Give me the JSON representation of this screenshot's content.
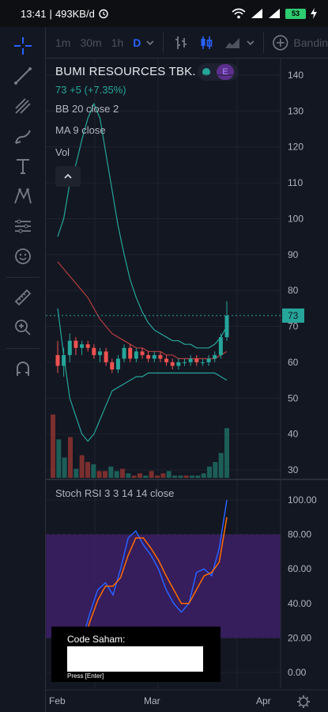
{
  "status_bar": {
    "time": "13:41",
    "network_speed": "493KB/d",
    "battery": "53"
  },
  "toolbar": {
    "timeframes": [
      "1m",
      "30m",
      "1h",
      "D"
    ],
    "active_timeframe": "D",
    "indicators_label": "Bandin"
  },
  "legend": {
    "symbol": "BUMI RESOURCES TBK.",
    "price": "73",
    "change": "+5 (+7.35%)",
    "bb_label": "BB",
    "bb_params": "20 close 2",
    "ma_label": "MA",
    "ma_params": "9 close",
    "vol_label": "Vol",
    "badge_letter": "E"
  },
  "price_axis": {
    "ticks": [
      "140",
      "130",
      "120",
      "110",
      "100",
      "90",
      "80",
      "70",
      "60",
      "50",
      "40",
      "30"
    ],
    "last_price": "73"
  },
  "rsi": {
    "label": "Stoch RSI",
    "params": "3 3 14 14 close",
    "ticks": [
      "100.00",
      "80.00",
      "60.00",
      "40.00",
      "20.00",
      "0.00"
    ]
  },
  "time_axis": {
    "labels": [
      "Feb",
      "Mar",
      "Apr"
    ]
  },
  "code_input": {
    "label": "Code Saham:",
    "hint": "Press [Enter]",
    "value": ""
  },
  "colors": {
    "up": "#26a69a",
    "down": "#ef5350",
    "bb_band": "#26a69a",
    "bb_basis": "#b33d3d",
    "rsi_k": "#2962ff",
    "rsi_d": "#ff6d00",
    "rsi_band": "#3d1f66",
    "background": "#131722"
  },
  "chart_data": [
    {
      "type": "candlestick",
      "title": "BUMI RESOURCES TBK.",
      "x_axis_labels": [
        "Feb",
        "Mar",
        "Apr"
      ],
      "ylim": [
        27,
        145
      ],
      "candles": [
        {
          "o": 62,
          "h": 66,
          "l": 57,
          "c": 59
        },
        {
          "o": 59,
          "h": 64,
          "l": 56,
          "c": 62
        },
        {
          "o": 62,
          "h": 68,
          "l": 60,
          "c": 66
        },
        {
          "o": 66,
          "h": 67,
          "l": 62,
          "c": 64
        },
        {
          "o": 64,
          "h": 66,
          "l": 62,
          "c": 65
        },
        {
          "o": 65,
          "h": 66,
          "l": 63,
          "c": 64
        },
        {
          "o": 64,
          "h": 65,
          "l": 61,
          "c": 62
        },
        {
          "o": 62,
          "h": 64,
          "l": 60,
          "c": 63
        },
        {
          "o": 63,
          "h": 64,
          "l": 59,
          "c": 60
        },
        {
          "o": 60,
          "h": 61,
          "l": 57,
          "c": 58
        },
        {
          "o": 58,
          "h": 62,
          "l": 57,
          "c": 61
        },
        {
          "o": 61,
          "h": 65,
          "l": 60,
          "c": 64
        },
        {
          "o": 64,
          "h": 65,
          "l": 60,
          "c": 61
        },
        {
          "o": 61,
          "h": 64,
          "l": 60,
          "c": 63
        },
        {
          "o": 63,
          "h": 64,
          "l": 61,
          "c": 62
        },
        {
          "o": 62,
          "h": 63,
          "l": 60,
          "c": 61
        },
        {
          "o": 61,
          "h": 63,
          "l": 60,
          "c": 62
        },
        {
          "o": 62,
          "h": 63,
          "l": 60,
          "c": 61
        },
        {
          "o": 61,
          "h": 62,
          "l": 59,
          "c": 60
        },
        {
          "o": 60,
          "h": 61,
          "l": 58,
          "c": 59
        },
        {
          "o": 59,
          "h": 61,
          "l": 58,
          "c": 60
        },
        {
          "o": 60,
          "h": 61,
          "l": 59,
          "c": 60
        },
        {
          "o": 60,
          "h": 62,
          "l": 59,
          "c": 61
        },
        {
          "o": 61,
          "h": 62,
          "l": 59,
          "c": 60
        },
        {
          "o": 60,
          "h": 61,
          "l": 59,
          "c": 60
        },
        {
          "o": 60,
          "h": 62,
          "l": 59,
          "c": 61
        },
        {
          "o": 61,
          "h": 63,
          "l": 60,
          "c": 62
        },
        {
          "o": 62,
          "h": 68,
          "l": 61,
          "c": 67
        },
        {
          "o": 67,
          "h": 77,
          "l": 66,
          "c": 73
        }
      ],
      "bollinger": {
        "upper": [
          95,
          100,
          110,
          115,
          122,
          128,
          132,
          128,
          118,
          108,
          98,
          90,
          83,
          78,
          74,
          71,
          69,
          68,
          67,
          66,
          66,
          65,
          65,
          64,
          64,
          64,
          65,
          67,
          70
        ],
        "basis": [
          88,
          86,
          84,
          82,
          80,
          78,
          75,
          72,
          70,
          68,
          67,
          66,
          65,
          64,
          64,
          63,
          63,
          63,
          62,
          62,
          61,
          61,
          61,
          61,
          61,
          61,
          61,
          62,
          63
        ],
        "lower": [
          75,
          62,
          50,
          45,
          40,
          38,
          40,
          44,
          48,
          52,
          53,
          54,
          55,
          56,
          56,
          57,
          57,
          57,
          57,
          57,
          57,
          57,
          57,
          57,
          57,
          57,
          57,
          56,
          55
        ]
      },
      "volume": [
        28,
        17,
        9,
        18,
        4,
        10,
        7,
        6,
        3,
        3,
        5,
        3,
        4,
        2,
        1,
        2,
        1,
        3,
        1,
        2,
        3,
        1,
        1,
        1,
        1,
        1,
        2,
        5,
        7,
        11,
        22
      ]
    },
    {
      "type": "line",
      "title": "Stoch RSI",
      "ylim": [
        0,
        100
      ],
      "series": [
        {
          "name": "K",
          "values": [
            10,
            20,
            35,
            48,
            52,
            45,
            60,
            78,
            82,
            74,
            68,
            60,
            48,
            40,
            35,
            40,
            58,
            60,
            56,
            72,
            100
          ]
        },
        {
          "name": "D",
          "values": [
            5,
            16,
            30,
            42,
            50,
            50,
            55,
            68,
            78,
            78,
            72,
            65,
            56,
            48,
            40,
            40,
            48,
            56,
            58,
            64,
            90
          ]
        }
      ],
      "band": [
        20,
        80
      ]
    }
  ]
}
